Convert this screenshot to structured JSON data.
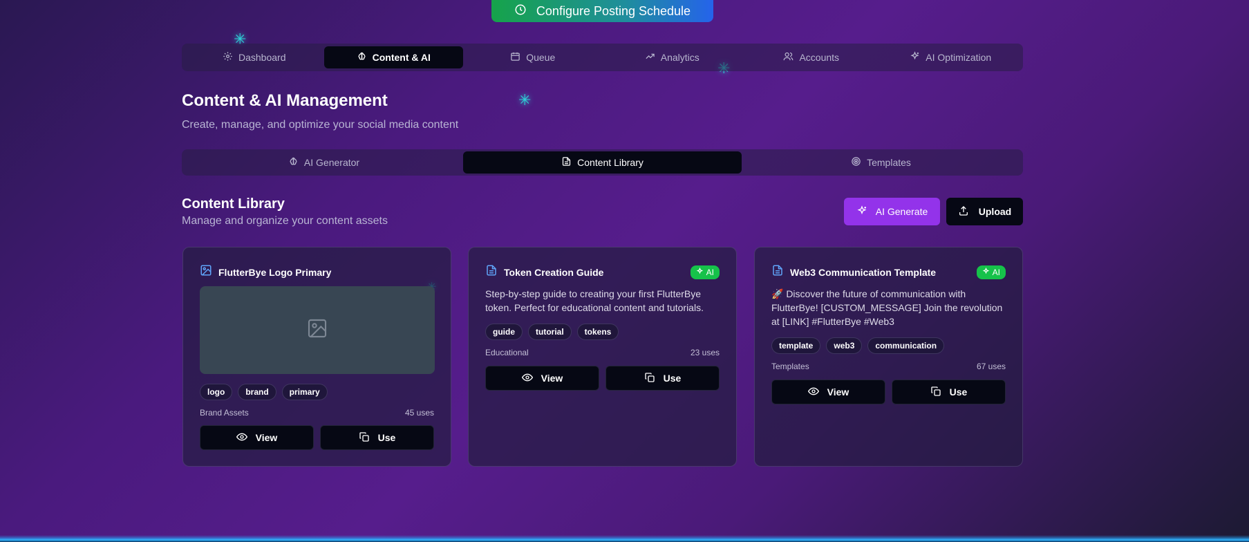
{
  "top_action": {
    "label": "Configure Posting Schedule",
    "icon": "clock-icon"
  },
  "main_nav": {
    "items": [
      {
        "label": "Dashboard",
        "icon": "gear-icon",
        "active": false
      },
      {
        "label": "Content & AI",
        "icon": "brain-icon",
        "active": true
      },
      {
        "label": "Queue",
        "icon": "calendar-icon",
        "active": false
      },
      {
        "label": "Analytics",
        "icon": "trending-up-icon",
        "active": false
      },
      {
        "label": "Accounts",
        "icon": "users-icon",
        "active": false
      },
      {
        "label": "AI Optimization",
        "icon": "sparkles-icon",
        "active": false
      }
    ]
  },
  "header": {
    "title": "Content & AI Management",
    "subtitle": "Create, manage, and optimize your social media content"
  },
  "sub_tabs": {
    "items": [
      {
        "label": "AI Generator",
        "icon": "brain-icon",
        "active": false
      },
      {
        "label": "Content Library",
        "icon": "file-text-icon",
        "active": true
      },
      {
        "label": "Templates",
        "icon": "target-icon",
        "active": false
      }
    ]
  },
  "library": {
    "title": "Content Library",
    "subtitle": "Manage and organize your content assets",
    "ai_generate_label": "AI Generate",
    "upload_label": "Upload"
  },
  "cards": [
    {
      "title": "FlutterBye Logo Primary",
      "icon": "image-icon",
      "ai": false,
      "tags": [
        "logo",
        "brand",
        "primary"
      ],
      "category": "Brand Assets",
      "uses": "45 uses",
      "view_label": "View",
      "use_label": "Use"
    },
    {
      "title": "Token Creation Guide",
      "icon": "file-text-icon",
      "ai": true,
      "badge": "AI",
      "description": "Step-by-step guide to creating your first FlutterBye token. Perfect for educational content and tutorials.",
      "tags": [
        "guide",
        "tutorial",
        "tokens"
      ],
      "category": "Educational",
      "uses": "23 uses",
      "view_label": "View",
      "use_label": "Use"
    },
    {
      "title": "Web3 Communication Template",
      "icon": "file-text-icon",
      "ai": true,
      "badge": "AI",
      "description": "🚀 Discover the future of communication with FlutterBye! [CUSTOM_MESSAGE] Join the revolution at [LINK] #FlutterBye #Web3",
      "tags": [
        "template",
        "web3",
        "communication"
      ],
      "category": "Templates",
      "uses": "67 uses",
      "view_label": "View",
      "use_label": "Use"
    }
  ],
  "colors": {
    "accent_purple": "#9333ea",
    "badge_green": "#16c24a",
    "active_tab_bg": "#060814",
    "icon_blue": "#60a5fa"
  }
}
